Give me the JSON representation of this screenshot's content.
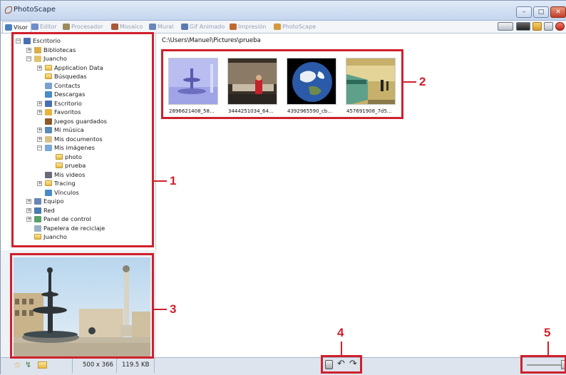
{
  "window": {
    "title": "PhotoScape",
    "buttons": [
      "–",
      "□",
      "✕"
    ]
  },
  "tabs": [
    {
      "label": "Visor",
      "active": true,
      "color": "#4a7fc1"
    },
    {
      "label": "Editor",
      "active": false,
      "color": "#6f8cc8"
    },
    {
      "label": "Procesador",
      "active": false,
      "color": "#9a8b5a"
    },
    {
      "label": "Mosaico",
      "active": false,
      "color": "#a65a3a"
    },
    {
      "label": "Mural",
      "active": false,
      "color": "#6a86b8"
    },
    {
      "label": "Gif Animado",
      "active": false,
      "color": "#5a7ab0"
    },
    {
      "label": "Impresión",
      "active": false,
      "color": "#c06a30"
    },
    {
      "label": "PhotoScape",
      "active": false,
      "color": "#d59a3a"
    }
  ],
  "tree": [
    {
      "label": "Escritorio",
      "icon": "desktop"
    },
    {
      "label": "Bibliotecas",
      "icon": "library"
    },
    {
      "label": "Juancho",
      "icon": "user-folder"
    },
    {
      "label": "Application Data",
      "icon": "folder"
    },
    {
      "label": "Búsquedas",
      "icon": "folder"
    },
    {
      "label": "Contacts",
      "icon": "contacts"
    },
    {
      "label": "Descargas",
      "icon": "downloads"
    },
    {
      "label": "Escritorio",
      "icon": "desktop"
    },
    {
      "label": "Favoritos",
      "icon": "star-folder"
    },
    {
      "label": "Juegos guardados",
      "icon": "games"
    },
    {
      "label": "Mi música",
      "icon": "music"
    },
    {
      "label": "Mis documentos",
      "icon": "documents"
    },
    {
      "label": "Mis imágenes",
      "icon": "pictures"
    },
    {
      "label": "photo",
      "icon": "folder"
    },
    {
      "label": "prueba",
      "icon": "folder"
    },
    {
      "label": "Mis videos",
      "icon": "videos"
    },
    {
      "label": "Tracing",
      "icon": "folder"
    },
    {
      "label": "Vínculos",
      "icon": "links"
    },
    {
      "label": "Equipo",
      "icon": "computer"
    },
    {
      "label": "Red",
      "icon": "network"
    },
    {
      "label": "Panel de control",
      "icon": "control-panel"
    },
    {
      "label": "Papelera de reciclaje",
      "icon": "recycle-bin"
    },
    {
      "label": "Juancho",
      "icon": "folder"
    }
  ],
  "main": {
    "path": "C:\\Users\\Manuel\\Pictures\\prueba",
    "thumbnails": [
      {
        "label": "2896621408_58...",
        "kind": "fountain-blue"
      },
      {
        "label": "3444251034_64...",
        "kind": "interior"
      },
      {
        "label": "4392965590_cb...",
        "kind": "earth"
      },
      {
        "label": "457691908_7d5...",
        "kind": "subway"
      }
    ]
  },
  "status": {
    "dimensions": "500 x 366",
    "filesize": "119.5 KB"
  },
  "callouts": [
    "1",
    "2",
    "3",
    "4",
    "5"
  ],
  "colors": {
    "callout": "#d0202c",
    "accent": "#4a7fc1"
  }
}
